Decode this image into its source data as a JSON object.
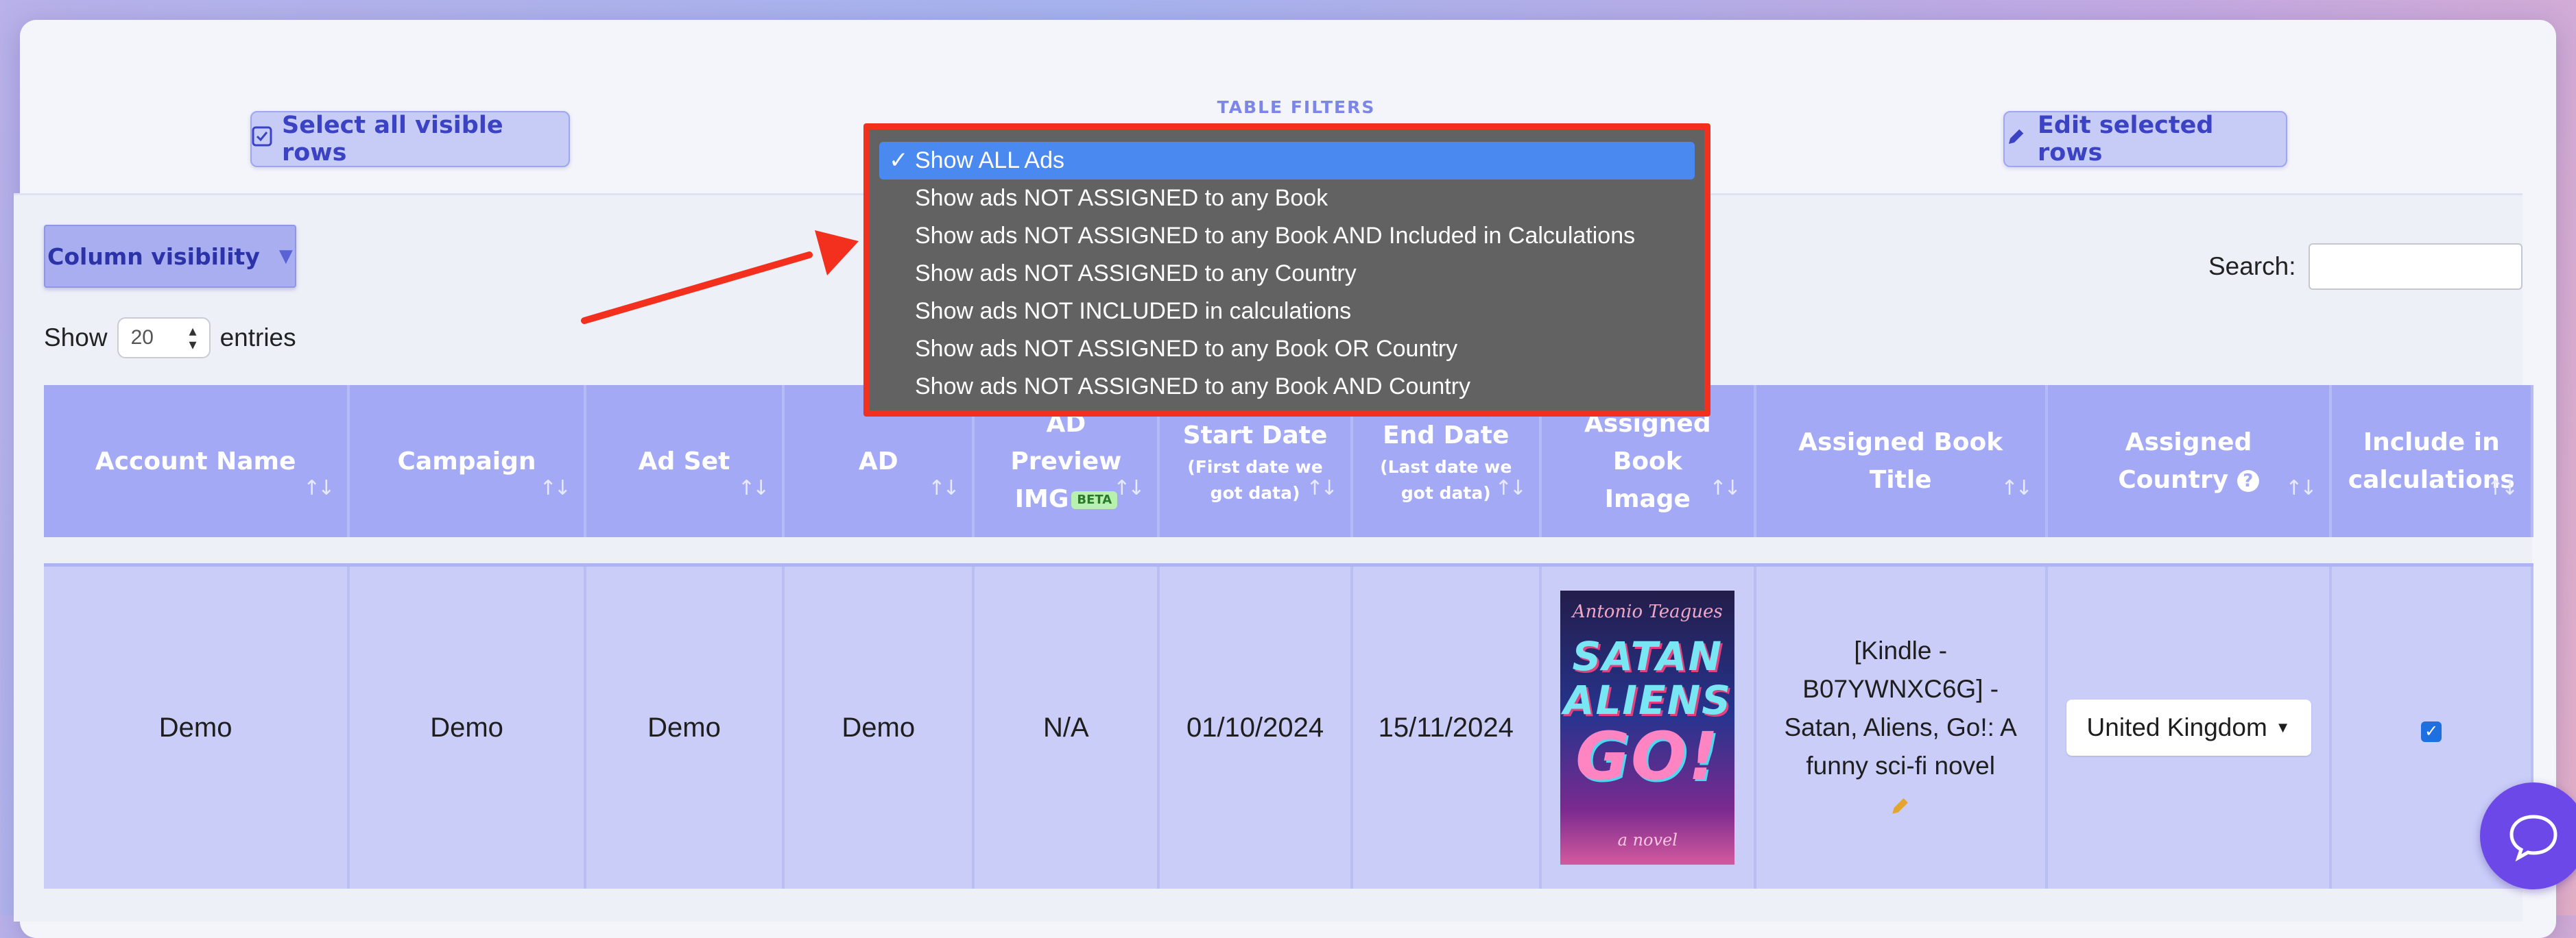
{
  "toolbar": {
    "filters_label": "TABLE FILTERS",
    "select_all_label": "Select all visible rows",
    "edit_selected_label": "Edit selected rows"
  },
  "filter_dropdown": {
    "selected": "Show ALL Ads",
    "options": [
      "Show ALL Ads",
      "Show ads NOT ASSIGNED to any Book",
      "Show ads NOT ASSIGNED to any Book AND Included in Calculations",
      "Show ads NOT ASSIGNED to any Country",
      "Show ads NOT INCLUDED in calculations",
      "Show ads NOT ASSIGNED to any Book OR Country",
      "Show ads NOT ASSIGNED to any Book AND Country"
    ]
  },
  "controls": {
    "column_visibility_label": "Column visibility",
    "show_label": "Show",
    "entries_value": "20",
    "entries_label": "entries",
    "search_label": "Search:",
    "search_value": ""
  },
  "table": {
    "headers": {
      "account_name": "Account Name",
      "campaign": "Campaign",
      "ad_set": "Ad Set",
      "ad": "AD",
      "ad_preview_1": "AD",
      "ad_preview_2": "Preview",
      "ad_preview_3": "IMG",
      "beta_badge": "BETA",
      "start_date": "Start Date",
      "start_date_sub": "(First date we got data)",
      "end_date": "End Date",
      "end_date_sub": "(Last date we got data)",
      "assigned_book_image_1": "Assigned",
      "assigned_book_image_2": "Book",
      "assigned_book_image_3": "Image",
      "assigned_book_title_1": "Assigned Book",
      "assigned_book_title_2": "Title",
      "assigned_country_1": "Assigned",
      "assigned_country_2": "Country",
      "include_1": "Include in",
      "include_2": "calculations"
    },
    "rows": [
      {
        "account_name": "Demo",
        "campaign": "Demo",
        "ad_set": "Demo",
        "ad": "Demo",
        "ad_preview": "N/A",
        "start_date": "01/10/2024",
        "end_date": "15/11/2024",
        "book_cover": {
          "author": "Antonio Teagues",
          "title_line1": "SATAN",
          "title_line2": "ALIENS",
          "title_line3": "GO!",
          "subtitle": "a novel"
        },
        "book_title": "[Kindle - B07YWNXC6G] - Satan, Aliens, Go!: A funny sci-fi novel",
        "country": "United Kingdom",
        "include_in_calculations": true
      }
    ]
  },
  "colors": {
    "accent": "#a3a9f4",
    "button_text": "#3b42c4",
    "highlight": "#f3301e",
    "selected_option": "#4a89f0"
  },
  "icons": [
    "checkbox-icon",
    "pencil-icon",
    "sort-icon",
    "help-icon",
    "chat-icon",
    "arrow-annotation"
  ]
}
